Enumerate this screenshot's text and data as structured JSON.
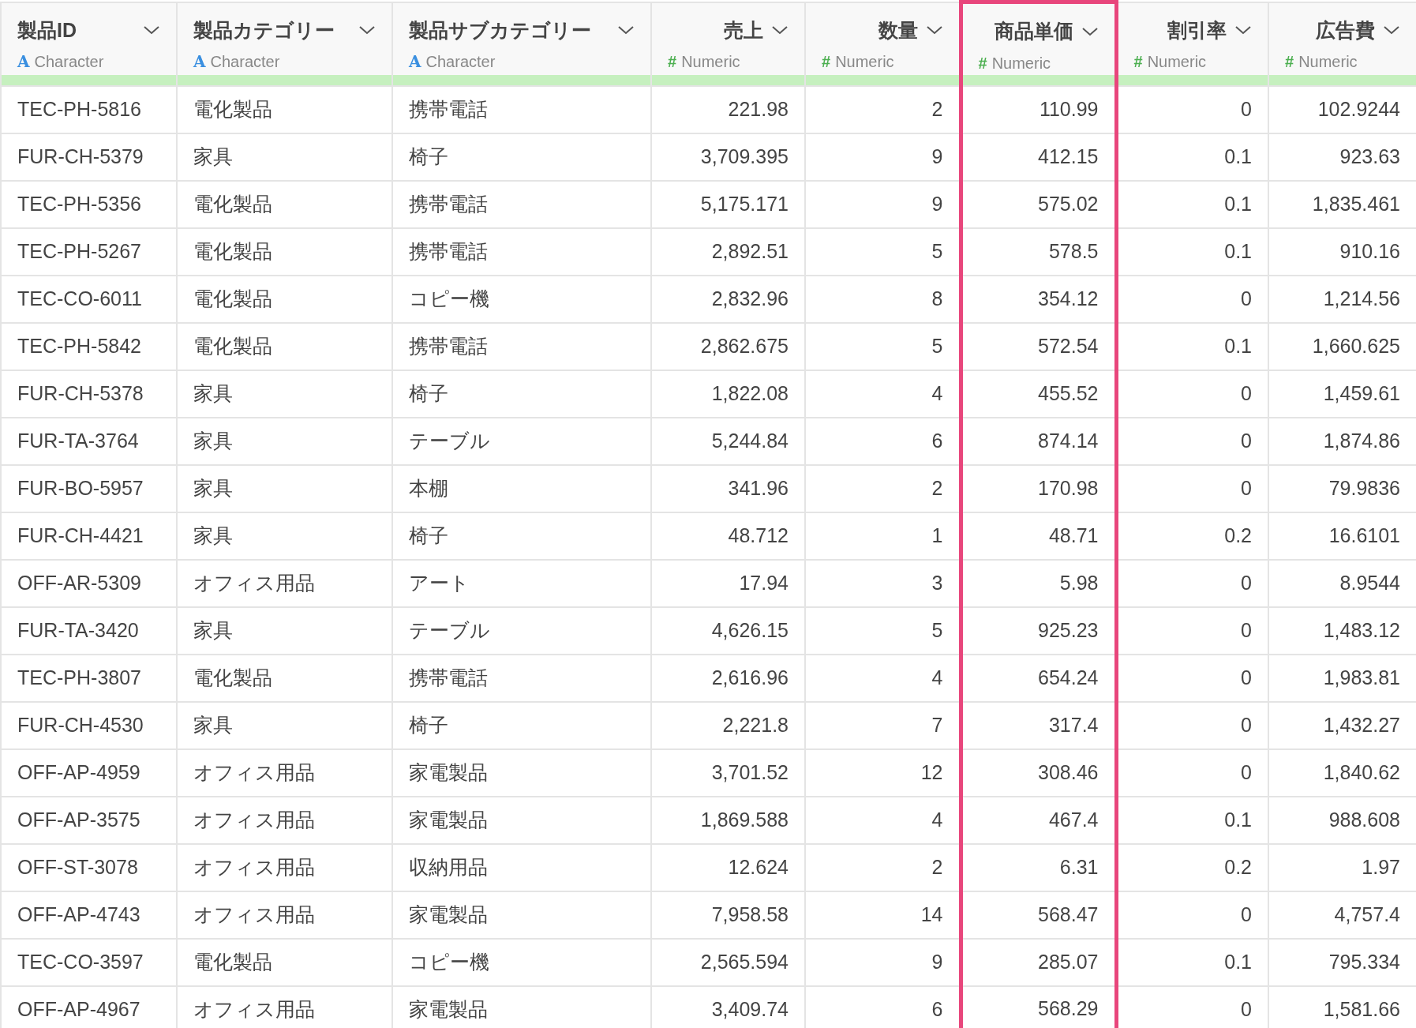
{
  "columns": [
    {
      "name": "製品ID",
      "kind": "character",
      "type_icon": "A",
      "type_label": "Character",
      "selected": false
    },
    {
      "name": "製品カテゴリー",
      "kind": "character",
      "type_icon": "A",
      "type_label": "Character",
      "selected": false
    },
    {
      "name": "製品サブカテゴリー",
      "kind": "character",
      "type_icon": "A",
      "type_label": "Character",
      "selected": false
    },
    {
      "name": "売上",
      "kind": "numeric",
      "type_icon": "#",
      "type_label": "Numeric",
      "selected": false
    },
    {
      "name": "数量",
      "kind": "numeric",
      "type_icon": "#",
      "type_label": "Numeric",
      "selected": false
    },
    {
      "name": "商品単価",
      "kind": "numeric",
      "type_icon": "#",
      "type_label": "Numeric",
      "selected": true
    },
    {
      "name": "割引率",
      "kind": "numeric",
      "type_icon": "#",
      "type_label": "Numeric",
      "selected": false
    },
    {
      "name": "広告費",
      "kind": "numeric",
      "type_icon": "#",
      "type_label": "Numeric",
      "selected": false
    }
  ],
  "rows": [
    [
      "TEC-PH-5816",
      "電化製品",
      "携帯電話",
      "221.98",
      "2",
      "110.99",
      "0",
      "102.9244"
    ],
    [
      "FUR-CH-5379",
      "家具",
      "椅子",
      "3,709.395",
      "9",
      "412.15",
      "0.1",
      "923.63"
    ],
    [
      "TEC-PH-5356",
      "電化製品",
      "携帯電話",
      "5,175.171",
      "9",
      "575.02",
      "0.1",
      "1,835.461"
    ],
    [
      "TEC-PH-5267",
      "電化製品",
      "携帯電話",
      "2,892.51",
      "5",
      "578.5",
      "0.1",
      "910.16"
    ],
    [
      "TEC-CO-6011",
      "電化製品",
      "コピー機",
      "2,832.96",
      "8",
      "354.12",
      "0",
      "1,214.56"
    ],
    [
      "TEC-PH-5842",
      "電化製品",
      "携帯電話",
      "2,862.675",
      "5",
      "572.54",
      "0.1",
      "1,660.625"
    ],
    [
      "FUR-CH-5378",
      "家具",
      "椅子",
      "1,822.08",
      "4",
      "455.52",
      "0",
      "1,459.61"
    ],
    [
      "FUR-TA-3764",
      "家具",
      "テーブル",
      "5,244.84",
      "6",
      "874.14",
      "0",
      "1,874.86"
    ],
    [
      "FUR-BO-5957",
      "家具",
      "本棚",
      "341.96",
      "2",
      "170.98",
      "0",
      "79.9836"
    ],
    [
      "FUR-CH-4421",
      "家具",
      "椅子",
      "48.712",
      "1",
      "48.71",
      "0.2",
      "16.6101"
    ],
    [
      "OFF-AR-5309",
      "オフィス用品",
      "アート",
      "17.94",
      "3",
      "5.98",
      "0",
      "8.9544"
    ],
    [
      "FUR-TA-3420",
      "家具",
      "テーブル",
      "4,626.15",
      "5",
      "925.23",
      "0",
      "1,483.12"
    ],
    [
      "TEC-PH-3807",
      "電化製品",
      "携帯電話",
      "2,616.96",
      "4",
      "654.24",
      "0",
      "1,983.81"
    ],
    [
      "FUR-CH-4530",
      "家具",
      "椅子",
      "2,221.8",
      "7",
      "317.4",
      "0",
      "1,432.27"
    ],
    [
      "OFF-AP-4959",
      "オフィス用品",
      "家電製品",
      "3,701.52",
      "12",
      "308.46",
      "0",
      "1,840.62"
    ],
    [
      "OFF-AP-3575",
      "オフィス用品",
      "家電製品",
      "1,869.588",
      "4",
      "467.4",
      "0.1",
      "988.608"
    ],
    [
      "OFF-ST-3078",
      "オフィス用品",
      "収納用品",
      "12.624",
      "2",
      "6.31",
      "0.2",
      "1.97"
    ],
    [
      "OFF-AP-4743",
      "オフィス用品",
      "家電製品",
      "7,958.58",
      "14",
      "568.47",
      "0",
      "4,757.4"
    ],
    [
      "TEC-CO-3597",
      "電化製品",
      "コピー機",
      "2,565.594",
      "9",
      "285.07",
      "0.1",
      "795.334"
    ],
    [
      "OFF-AP-4967",
      "オフィス用品",
      "家電製品",
      "3,409.74",
      "6",
      "568.29",
      "0",
      "1,581.66"
    ]
  ]
}
